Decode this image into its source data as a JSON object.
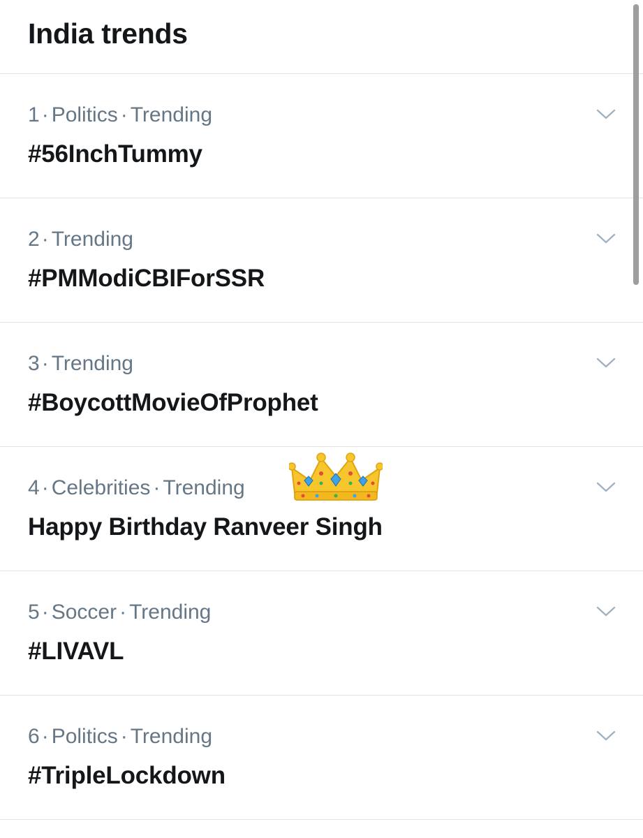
{
  "header": {
    "title": "India trends"
  },
  "trends": [
    {
      "rank": "1",
      "category": "Politics",
      "status": "Trending",
      "name": "#56InchTummy"
    },
    {
      "rank": "2",
      "category": "",
      "status": "Trending",
      "name": "#PMModiCBIForSSR"
    },
    {
      "rank": "3",
      "category": "",
      "status": "Trending",
      "name": "#BoycottMovieOfProphet"
    },
    {
      "rank": "4",
      "category": "Celebrities",
      "status": "Trending",
      "name": "Happy Birthday Ranveer Singh"
    },
    {
      "rank": "5",
      "category": "Soccer",
      "status": "Trending",
      "name": "#LIVAVL"
    },
    {
      "rank": "6",
      "category": "Politics",
      "status": "Trending",
      "name": "#TripleLockdown"
    }
  ],
  "icons": {
    "more": "chevron-down-icon",
    "emoji": "crown-emoji"
  },
  "colors": {
    "meta_text": "#657786",
    "primary_text": "#14171a",
    "divider": "#dfe3e8",
    "chevron": "#a3b2c0"
  }
}
